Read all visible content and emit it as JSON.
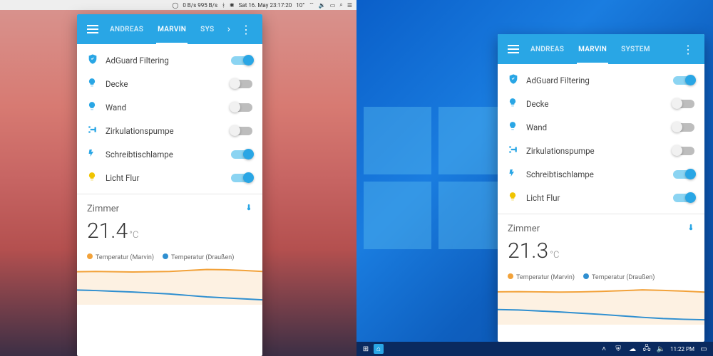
{
  "colors": {
    "accent": "#29a6e5",
    "orange": "#f2a23a",
    "blue": "#2f8fd0"
  },
  "mac": {
    "menubar": {
      "net": "0 B/s 995 B/s",
      "date": "Sat 16. May 23:17:20",
      "temp": "10°"
    },
    "card": {
      "tabs": [
        "ANDREAS",
        "MARVIN",
        "SYS"
      ],
      "activeTab": 1,
      "showChevron": true,
      "items": [
        {
          "icon": "shield",
          "label": "AdGuard Filtering",
          "on": true,
          "lit": false
        },
        {
          "icon": "bulb",
          "label": "Decke",
          "on": false,
          "lit": false
        },
        {
          "icon": "bulb",
          "label": "Wand",
          "on": false,
          "lit": false
        },
        {
          "icon": "pump",
          "label": "Zirkulationspumpe",
          "on": false,
          "lit": false
        },
        {
          "icon": "bolt",
          "label": "Schreibtischlampe",
          "on": true,
          "lit": false
        },
        {
          "icon": "bulb",
          "label": "Licht Flur",
          "on": true,
          "lit": true
        }
      ],
      "room": {
        "title": "Zimmer",
        "temp": "21.4",
        "unit": "°C"
      },
      "legend": [
        {
          "color": "#f2a23a",
          "label": "Temperatur (Marvin)"
        },
        {
          "color": "#2f8fd0",
          "label": "Temperatur (Draußen)"
        }
      ]
    }
  },
  "win": {
    "taskbar": {
      "time": "11:22 PM"
    },
    "card": {
      "tabs": [
        "ANDREAS",
        "MARVIN",
        "SYSTEM"
      ],
      "activeTab": 1,
      "showChevron": false,
      "items": [
        {
          "icon": "shield",
          "label": "AdGuard Filtering",
          "on": true,
          "lit": false
        },
        {
          "icon": "bulb",
          "label": "Decke",
          "on": false,
          "lit": false
        },
        {
          "icon": "bulb",
          "label": "Wand",
          "on": false,
          "lit": false
        },
        {
          "icon": "pump",
          "label": "Zirkulationspumpe",
          "on": false,
          "lit": false
        },
        {
          "icon": "bolt",
          "label": "Schreibtischlampe",
          "on": true,
          "lit": false
        },
        {
          "icon": "bulb",
          "label": "Licht Flur",
          "on": true,
          "lit": true
        }
      ],
      "room": {
        "title": "Zimmer",
        "temp": "21.3",
        "unit": "°C"
      },
      "legend": [
        {
          "color": "#f2a23a",
          "label": "Temperatur (Marvin)"
        },
        {
          "color": "#2f8fd0",
          "label": "Temperatur (Draußen)"
        }
      ]
    }
  },
  "chart_data": [
    {
      "type": "line",
      "title": "Zimmer (mac)",
      "x": [
        0,
        1,
        2,
        3,
        4,
        5,
        6,
        7,
        8,
        9,
        10
      ],
      "series": [
        {
          "name": "Temperatur (Marvin)",
          "color": "#f2a23a",
          "values": [
            21.5,
            21.6,
            21.5,
            21.4,
            21.5,
            21.6,
            22.0,
            22.4,
            22.3,
            22.0,
            21.6
          ]
        },
        {
          "name": "Temperatur (Draußen)",
          "color": "#2f8fd0",
          "values": [
            14.0,
            13.8,
            13.5,
            13.2,
            12.8,
            12.4,
            11.8,
            11.2,
            10.8,
            10.4,
            10.0
          ]
        }
      ],
      "ylim": [
        8,
        24
      ]
    },
    {
      "type": "line",
      "title": "Zimmer (win)",
      "x": [
        0,
        1,
        2,
        3,
        4,
        5,
        6,
        7,
        8,
        9,
        10
      ],
      "series": [
        {
          "name": "Temperatur (Marvin)",
          "color": "#f2a23a",
          "values": [
            21.4,
            21.5,
            21.4,
            21.3,
            21.4,
            21.6,
            21.9,
            22.2,
            22.0,
            21.7,
            21.3
          ]
        },
        {
          "name": "Temperatur (Draußen)",
          "color": "#2f8fd0",
          "values": [
            14.2,
            14.0,
            13.6,
            13.2,
            12.7,
            12.2,
            11.6,
            11.0,
            10.5,
            10.2,
            10.0
          ]
        }
      ],
      "ylim": [
        8,
        24
      ]
    }
  ]
}
